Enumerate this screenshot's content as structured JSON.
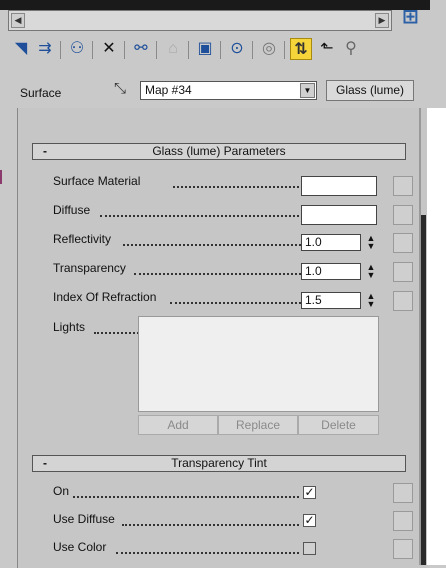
{
  "toolbar": {
    "icons": [
      "get-material-icon",
      "put-to-scene-icon",
      "assign-material-icon",
      "reset-icon",
      "make-unique-icon",
      "put-to-library-icon",
      "material-effects-channel-icon",
      "show-map-icon",
      "show-end-result-icon",
      "go-to-parent-icon",
      "go-forward-icon"
    ]
  },
  "surface": {
    "label": "Surface",
    "map_value": "Map #34",
    "type_button": "Glass (lume)"
  },
  "glass_rollout": {
    "title": "Glass (lume) Parameters",
    "collapse": "-",
    "surface_material_label": "Surface Material",
    "diffuse_label": "Diffuse",
    "reflectivity_label": "Reflectivity",
    "reflectivity_value": "1.0",
    "transparency_label": "Transparency",
    "transparency_value": "1.0",
    "ior_label": "Index Of Refraction",
    "ior_value": "1.5",
    "lights_label": "Lights",
    "add_label": "Add",
    "replace_label": "Replace",
    "delete_label": "Delete"
  },
  "tint_rollout": {
    "title": "Transparency Tint",
    "collapse": "-",
    "on_label": "On",
    "on_checked": true,
    "use_diffuse_label": "Use Diffuse",
    "use_diffuse_checked": true,
    "use_color_label": "Use Color",
    "use_color_checked": false
  },
  "colors": {
    "panel_bg": "#c6c6c6",
    "active_toggle": "#f5d53a",
    "icon_blue": "#1f4f9a"
  }
}
